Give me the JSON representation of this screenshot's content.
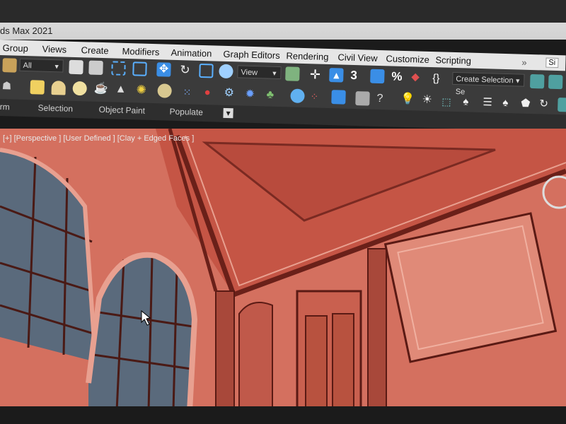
{
  "window": {
    "title": "ds Max 2021"
  },
  "menu": [
    "Group",
    "Views",
    "Create",
    "Modifiers",
    "Animation",
    "Graph Editors",
    "Rendering",
    "Civil View",
    "Customize",
    "Scripting"
  ],
  "toolbar": {
    "filter_value": "All",
    "coord_value": "View",
    "selection_set_placeholder": "Create Selection Se",
    "overflow": "»",
    "user_initial": "Si"
  },
  "ribbon": {
    "tabs": [
      "rm",
      "Selection",
      "Object Paint",
      "Populate"
    ]
  },
  "viewport": {
    "label_plus": "[+]",
    "label_view": "[Perspective ]",
    "label_shading": "[User Defined ]",
    "label_style": "[Clay + Edged Faces ]"
  },
  "colors": {
    "clay": "#d06a5a",
    "glass": "#5a6a7c",
    "ui_dark": "#3b3b3b",
    "menu_bg": "#e6e6e6"
  }
}
